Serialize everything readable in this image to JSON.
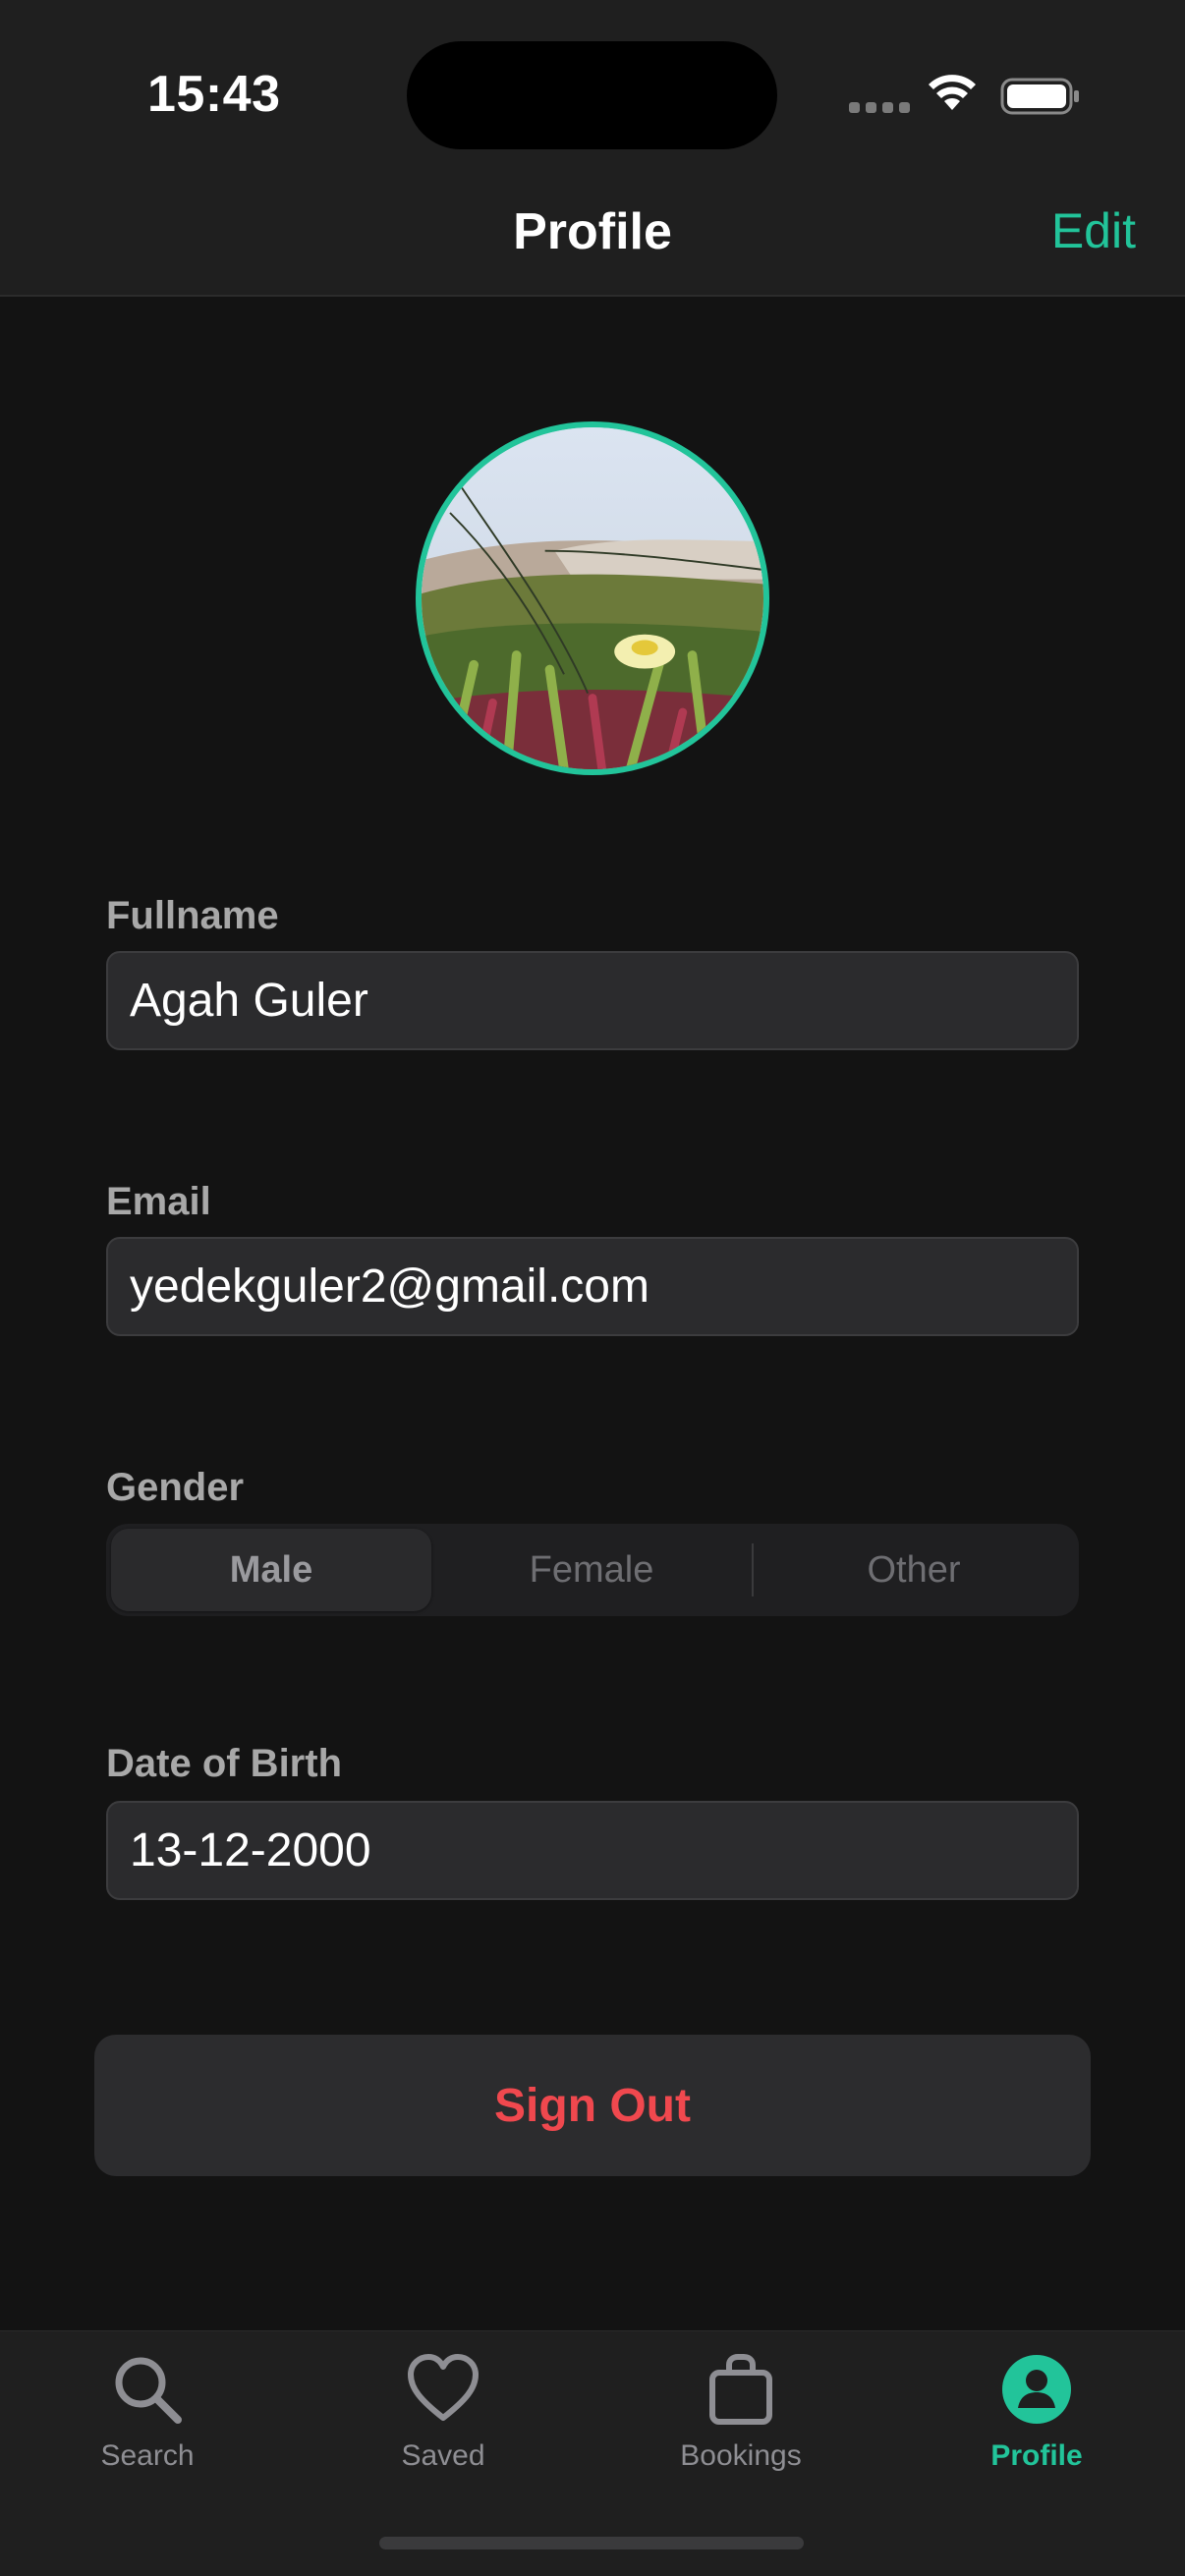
{
  "status_bar": {
    "time": "15:43"
  },
  "nav": {
    "title": "Profile",
    "edit_label": "Edit"
  },
  "form": {
    "fullname": {
      "label": "Fullname",
      "value": "Agah Guler"
    },
    "email": {
      "label": "Email",
      "value": "yedekguler2@gmail.com"
    },
    "gender": {
      "label": "Gender",
      "options": [
        "Male",
        "Female",
        "Other"
      ],
      "selected": "Male"
    },
    "dob": {
      "label": "Date of Birth",
      "value": "13-12-2000"
    }
  },
  "signout_label": "Sign Out",
  "tabbar": {
    "items": [
      {
        "label": "Search",
        "icon": "search-icon"
      },
      {
        "label": "Saved",
        "icon": "heart-icon"
      },
      {
        "label": "Bookings",
        "icon": "bag-icon"
      },
      {
        "label": "Profile",
        "icon": "person-circle-icon",
        "active": true
      }
    ]
  },
  "colors": {
    "accent": "#22c49a",
    "destructive": "#f0484e",
    "background": "#131313"
  }
}
